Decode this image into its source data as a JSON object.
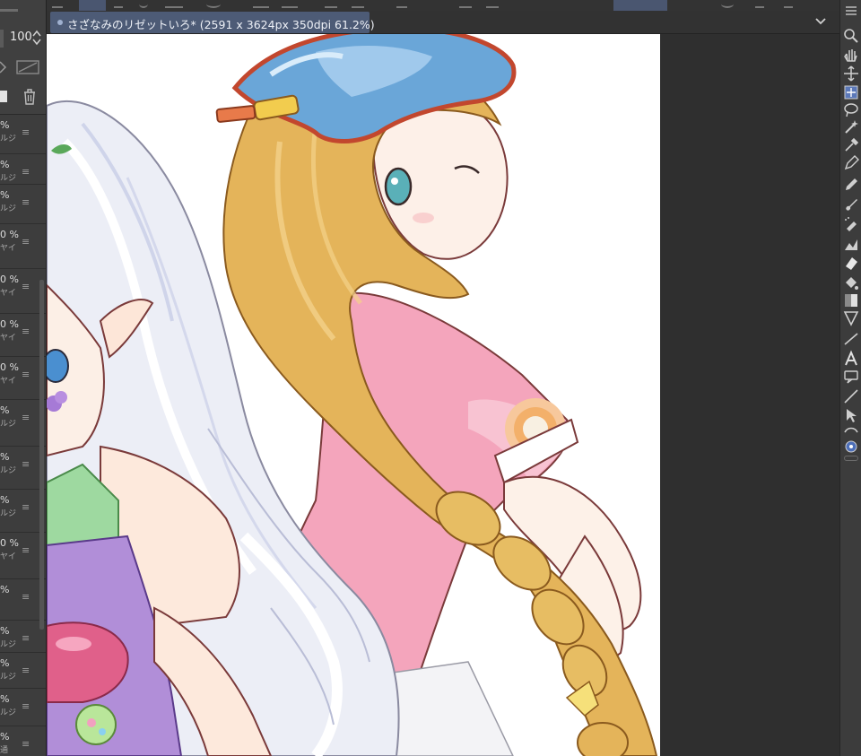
{
  "app": {
    "document_tab": {
      "title": "さざなみのリゼットいろ* (2591 x 3624px 350dpi 61.2%)"
    }
  },
  "layer_panel": {
    "opacity_value": "100",
    "layers": [
      {
        "opacity": "%",
        "mode": "ルジ"
      },
      {
        "opacity": "%",
        "mode": "ルジ"
      },
      {
        "opacity": "%",
        "mode": "ルジ"
      },
      {
        "opacity": "0 %",
        "mode": "ヤイ"
      },
      {
        "opacity": "0 %",
        "mode": "ヤイ"
      },
      {
        "opacity": "0 %",
        "mode": "ヤイ"
      },
      {
        "opacity": "0 %",
        "mode": "ヤイ"
      },
      {
        "opacity": "%",
        "mode": "ルジ"
      },
      {
        "opacity": "%",
        "mode": "ルジ"
      },
      {
        "opacity": "%",
        "mode": "ルジ"
      },
      {
        "opacity": "0 %",
        "mode": "ヤイ"
      },
      {
        "opacity": "%",
        "mode": ""
      },
      {
        "opacity": "%",
        "mode": "ルジ"
      },
      {
        "opacity": "%",
        "mode": "ルジ"
      },
      {
        "opacity": "%",
        "mode": "ルジ"
      },
      {
        "opacity": "%",
        "mode": "通"
      }
    ]
  },
  "tools": [
    "zoom-icon",
    "hand-icon",
    "move-icon",
    "move-layer-icon",
    "lasso-icon",
    "magic-wand-icon",
    "eyedropper-icon",
    "pen-icon",
    "pencil-icon",
    "brush-icon",
    "airbrush-icon",
    "decoration-icon",
    "eraser-icon",
    "fill-icon",
    "gradient-icon",
    "figure-icon",
    "frame-icon",
    "text-icon",
    "balloon-icon",
    "ruler-icon",
    "object-select-icon",
    "correct-line-icon",
    "color-circle-icon"
  ],
  "colors": {
    "tab_active": "#4d5b76",
    "panel_bg": "#3a3a3a",
    "canvas_bg": "#2f2f2f"
  }
}
